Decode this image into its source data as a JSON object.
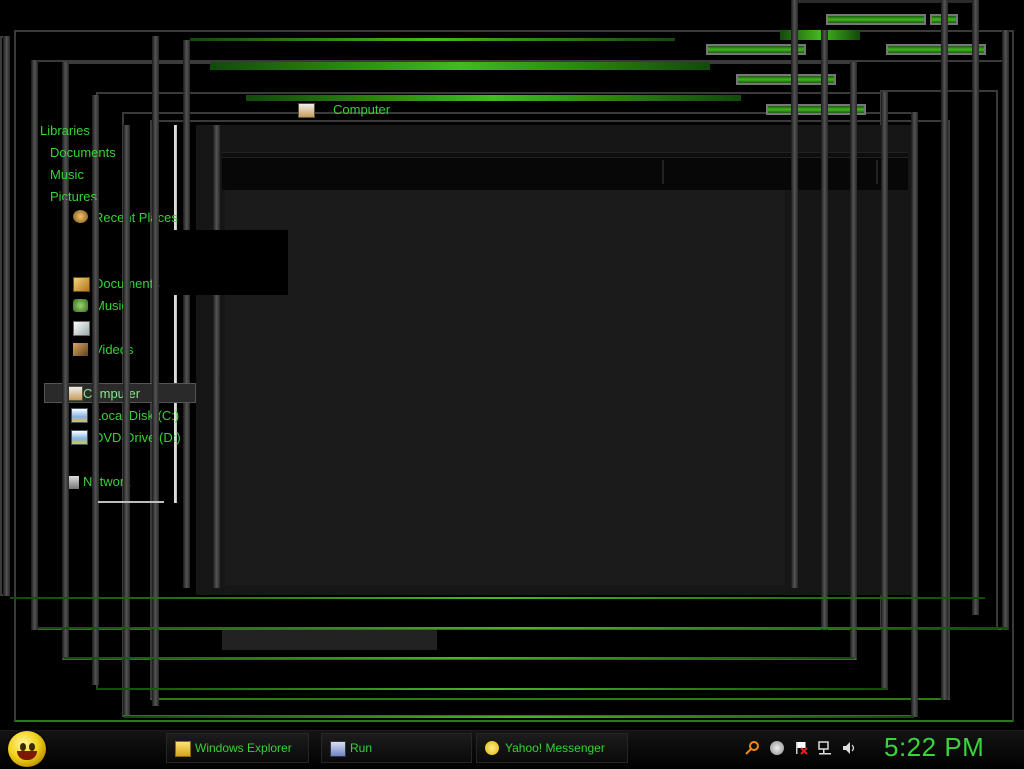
{
  "address_bar": {
    "location": "Computer"
  },
  "nav_pane": {
    "libraries": "Libraries",
    "documents": "Documents",
    "music": "Music",
    "pictures": "Pictures",
    "recent_places": "Recent Places",
    "fav_documents": "Documents",
    "fav_music": "Music",
    "fav_videos": "Videos",
    "computer": "Computer",
    "local_disk": "Local Disk (C:)",
    "dvd_drive": "DVD Drive (D:)",
    "network": "Network"
  },
  "taskbar": {
    "start_icon": "yahoo-smiley-icon",
    "tasks": [
      {
        "label": "Windows Explorer",
        "icon": "folder-icon"
      },
      {
        "label": "Run",
        "icon": "run-icon"
      },
      {
        "label": "Yahoo! Messenger",
        "icon": "yahoo-smiley-icon"
      }
    ],
    "tray_icons": [
      "search-icon",
      "messenger-icon",
      "action-center-flag-icon",
      "network-icon",
      "volume-icon"
    ],
    "clock": "5:22 PM"
  },
  "colors": {
    "accent": "#36d336",
    "background": "#000000",
    "panel": "#161616"
  }
}
